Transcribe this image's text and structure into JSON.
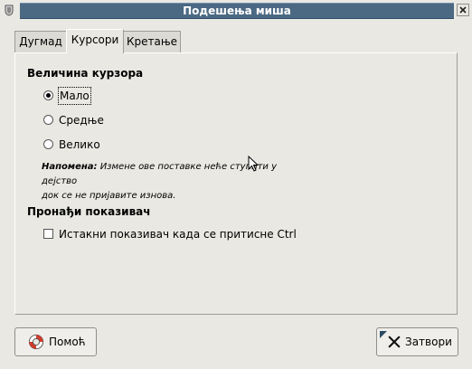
{
  "window": {
    "title": "Подешења миша"
  },
  "tabs": [
    {
      "label": "Дугмад",
      "active": false
    },
    {
      "label": "Курсори",
      "active": true
    },
    {
      "label": "Кретање",
      "active": false
    }
  ],
  "cursor_size": {
    "heading": "Величина курзора",
    "options": [
      {
        "label": "Мало",
        "selected": true
      },
      {
        "label": "Средње",
        "selected": false
      },
      {
        "label": "Велико",
        "selected": false
      }
    ]
  },
  "note": {
    "prefix": "Напомена:",
    "line1": "Измене ове поставке неће ступити у дејство",
    "line2": "док се не пријавите изнова."
  },
  "locate_pointer": {
    "heading": "Пронађи показивач",
    "checkbox_label": "Истакни показивач када се притисне Ctrl",
    "checked": false
  },
  "buttons": {
    "help": "Помоћ",
    "close": "Затвори"
  },
  "icons": {
    "window": "window-menu-icon",
    "close": "close-window-icon",
    "help": "lifebuoy-icon",
    "close_button": "close-x-icon"
  }
}
